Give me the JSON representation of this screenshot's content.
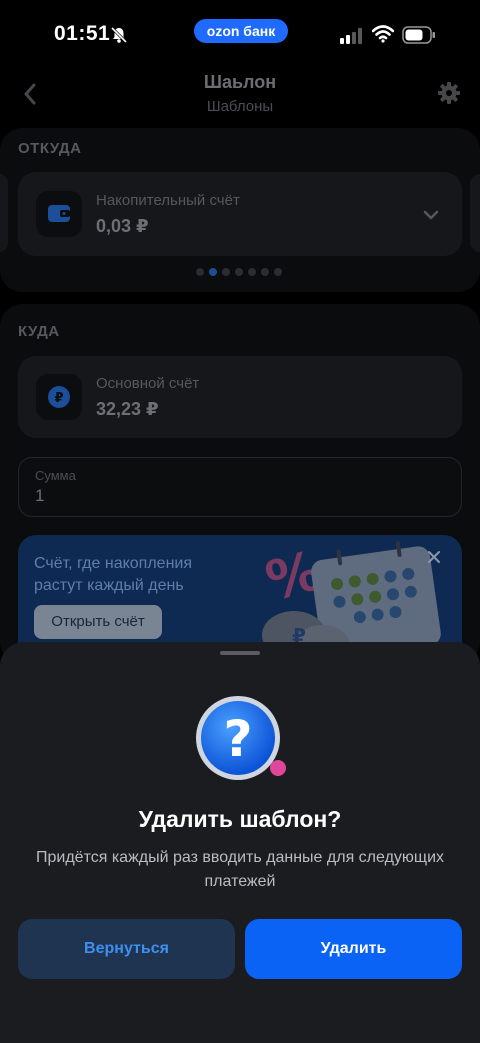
{
  "status_bar": {
    "time": "01:51",
    "brand": "ozon банк"
  },
  "header": {
    "title": "Шаьлон",
    "subtitle": "Шаблоны"
  },
  "from": {
    "label": "ОТКУДА",
    "account_name": "Накопительный счёт",
    "account_amount": "0,03 ₽",
    "pager_count": 7,
    "pager_active": 1
  },
  "to": {
    "label": "КУДА",
    "account_name": "Основной счёт",
    "account_amount": "32,23 ₽"
  },
  "amount_field": {
    "label": "Сумма",
    "value": "1"
  },
  "promo": {
    "text": "Счёт, где накопления растут каждый день",
    "button": "Открыть счёт"
  },
  "dialog": {
    "title": "Удалить шаблон?",
    "description": "Придётся каждый раз вводить данные для следующих платежей",
    "cancel_label": "Вернуться",
    "confirm_label": "Удалить"
  },
  "colors": {
    "accent": "#0a63f5",
    "sheet_bg": "#1b1c20",
    "cancel_bg": "#1e3450"
  }
}
